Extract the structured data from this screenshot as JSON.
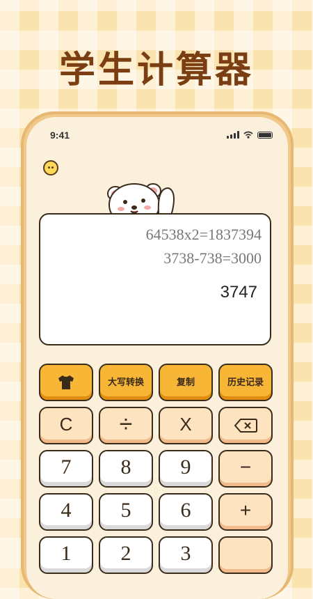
{
  "promo": {
    "title": "学生计算器"
  },
  "status_bar": {
    "time": "9:41"
  },
  "display": {
    "history": [
      "64538x2=1837394",
      "3738-738=3000"
    ],
    "current": "3747"
  },
  "function_keys": {
    "theme_icon": "shirt-icon",
    "uppercase": "大写转换",
    "copy": "复制",
    "history": "历史记录"
  },
  "keys": {
    "clear": "C",
    "divide": "÷",
    "multiply": "X",
    "backspace_icon": "backspace-icon",
    "seven": "7",
    "eight": "8",
    "nine": "9",
    "minus": "−",
    "four": "4",
    "five": "5",
    "six": "6",
    "plus": "+",
    "one": "1",
    "two": "2",
    "three": "3"
  },
  "colors": {
    "background": "#fbe3b0",
    "accent_orange": "#f8b637",
    "title_brown": "#7a3e12",
    "key_peach": "#fde3c0"
  }
}
